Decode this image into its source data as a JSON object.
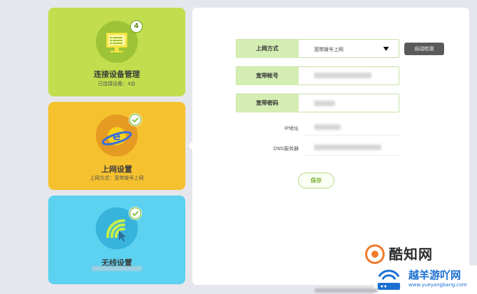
{
  "sidebar": {
    "cards": [
      {
        "title": "连接设备管理",
        "subtitle": "已连接设备：4台",
        "badge": "4",
        "icon": "monitor-icon",
        "color": "#c2dd4d"
      },
      {
        "title": "上网设置",
        "subtitle": "上网方式：宽带拨号上网",
        "icon": "ie-globe-icon",
        "color": "#f6c12e"
      },
      {
        "title": "无线设置",
        "icon": "wifi-icon",
        "color": "#5cd1f0"
      }
    ]
  },
  "form": {
    "connection_type": {
      "label": "上网方式",
      "value": "宽带拨号上网"
    },
    "auto_detect_label": "自动检测",
    "account": {
      "label": "宽带帐号"
    },
    "password": {
      "label": "宽带密码"
    },
    "ip": {
      "label": "IP地址"
    },
    "dns": {
      "label": "DNS服务器"
    },
    "save_label": "保存"
  },
  "watermarks": {
    "brand1": "酷知网",
    "brand2": "越羊游吖网",
    "brand2_url": "www.yueyangbang.com"
  }
}
